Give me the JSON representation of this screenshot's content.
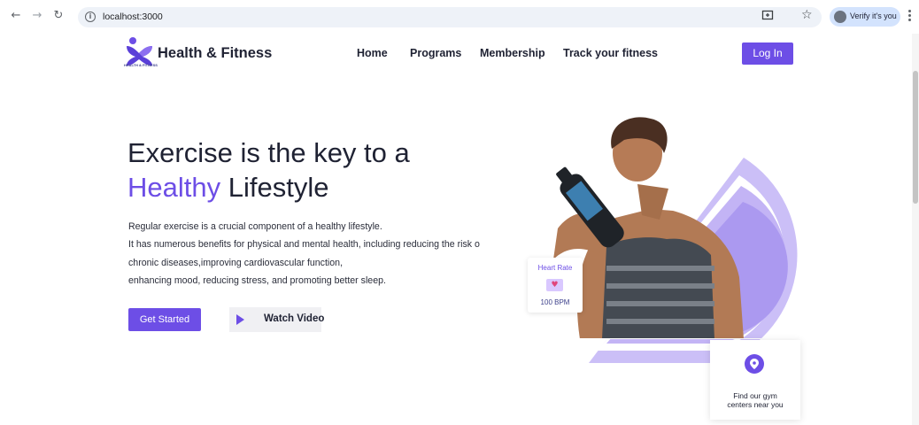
{
  "browser": {
    "back_icon": "arrow-left-icon",
    "forward_icon": "arrow-right-icon",
    "reload_icon": "reload-icon",
    "url": "localhost:3000",
    "profile_label": "Verify it's you"
  },
  "header": {
    "logo_caption": "HEALTH & FITNESS",
    "brand": "Health & Fitness",
    "nav": [
      "Home",
      "Programs",
      "Membership",
      "Track your fitness"
    ],
    "login_label": "Log In"
  },
  "hero": {
    "title_line1": "Exercise is the key to a",
    "title_accent": "Healthy",
    "title_rest": "Lifestyle",
    "paragraph": [
      "Regular exercise is a crucial component of a healthy lifestyle.",
      "It has numerous benefits for physical and mental health, including reducing the risk o",
      "chronic diseases,improving cardiovascular function,",
      "enhancing mood, reducing stress, and promoting better sleep."
    ],
    "cta_primary": "Get Started",
    "cta_secondary": "Watch Video"
  },
  "heart_card": {
    "title": "Heart Rate",
    "value": "100 BPM"
  },
  "gym_card": {
    "line1": "Find our gym",
    "line2": "centers near you"
  },
  "colors": {
    "accent": "#6d4ee6",
    "ring_light": "#cbbff7",
    "ring_mid": "#ab99f0",
    "text_dark": "#1f2233"
  }
}
